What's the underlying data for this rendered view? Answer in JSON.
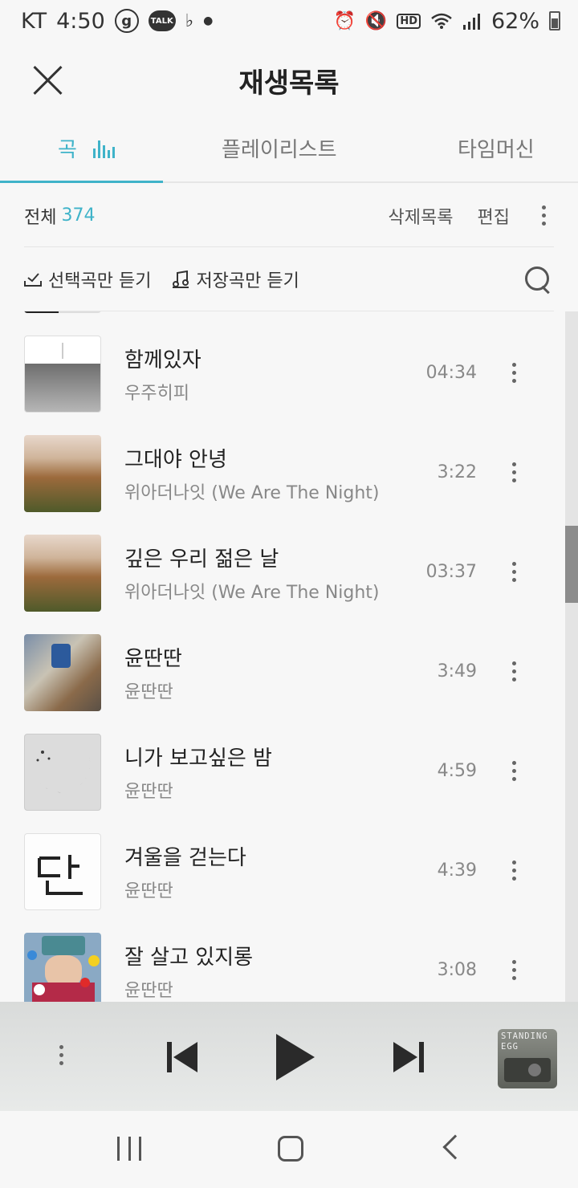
{
  "status_bar": {
    "carrier": "KT",
    "time": "4:50",
    "battery": "62%",
    "left_icons": [
      "g-icon",
      "talk-icon",
      "notification-icon"
    ],
    "right_icons": [
      "alarm-icon",
      "mute-icon",
      "hd-icon",
      "wifi-icon",
      "signal-icon",
      "battery-icon"
    ]
  },
  "header": {
    "title": "재생목록"
  },
  "tabs": [
    {
      "label": "곡",
      "active": true
    },
    {
      "label": "플레이리스트",
      "active": false
    },
    {
      "label": "타임머신",
      "active": false
    }
  ],
  "summary": {
    "total_label": "전체",
    "total_count": "374",
    "deleted_list": "삭제목록",
    "edit": "편집"
  },
  "filters": {
    "selected_only": "선택곡만 듣기",
    "saved_only": "저장곡만 듣기"
  },
  "songs": [
    {
      "title": "함께있자",
      "artist": "우주히피",
      "duration": "04:34"
    },
    {
      "title": "그대야 안녕",
      "artist": "위아더나잇 (We Are The Night)",
      "duration": "3:22"
    },
    {
      "title": "깊은 우리 젊은 날",
      "artist": "위아더나잇 (We Are The Night)",
      "duration": "03:37"
    },
    {
      "title": "윤딴딴",
      "artist": "윤딴딴",
      "duration": "3:49"
    },
    {
      "title": "니가 보고싶은 밤",
      "artist": "윤딴딴",
      "duration": "4:59"
    },
    {
      "title": "겨울을 걷는다",
      "artist": "윤딴딴",
      "duration": "4:39"
    },
    {
      "title": "잘 살고 있지롱",
      "artist": "윤딴딴",
      "duration": "3:08"
    }
  ],
  "scroll_position": 0.35,
  "player": {
    "album_text": "STANDING EGG"
  },
  "colors": {
    "accent": "#3fb3c9",
    "text": "#222222",
    "muted": "#888888",
    "background": "#f7f7f7"
  }
}
